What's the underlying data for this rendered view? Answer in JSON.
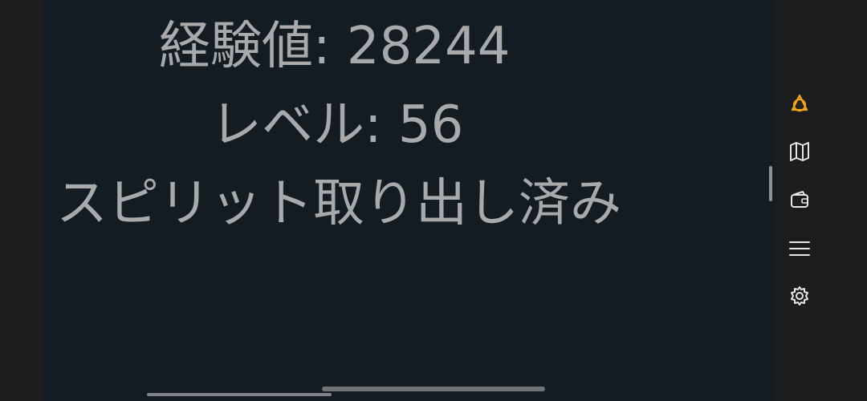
{
  "stats": {
    "experience": "経験値: 28244",
    "level": "レベル: 56",
    "spirit_status": "スピリット取り出し済み"
  },
  "sidebar": {
    "items": [
      {
        "icon": "spirit-ring-icon",
        "active": true
      },
      {
        "icon": "map-icon",
        "active": false
      },
      {
        "icon": "wallet-icon",
        "active": false
      },
      {
        "icon": "menu-icon",
        "active": false
      },
      {
        "icon": "gear-icon",
        "active": false
      }
    ]
  },
  "colors": {
    "content_background": "#131c23",
    "chrome_background": "#1c1d1f",
    "text": "#a7a9ab",
    "accent": "#f3a51b",
    "icon": "#e6e6e6"
  }
}
